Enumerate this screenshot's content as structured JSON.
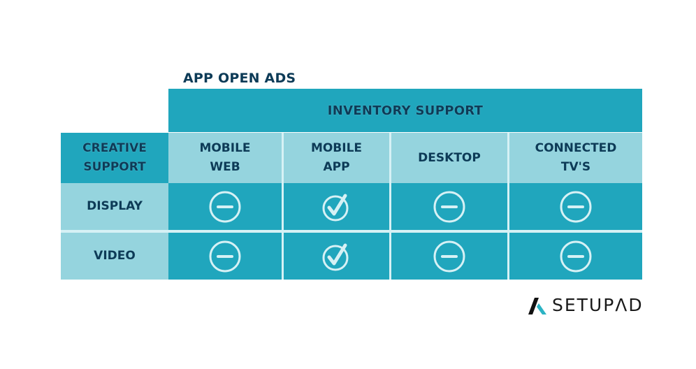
{
  "title": "APP OPEN ADS",
  "table": {
    "group_header": "INVENTORY SUPPORT",
    "corner_label": [
      "CREATIVE",
      "SUPPORT"
    ],
    "columns": [
      {
        "id": "mobile-web",
        "lines": [
          "MOBILE",
          "WEB"
        ]
      },
      {
        "id": "mobile-app",
        "lines": [
          "MOBILE",
          "APP"
        ]
      },
      {
        "id": "desktop",
        "lines": [
          "DESKTOP"
        ]
      },
      {
        "id": "connected-tv",
        "lines": [
          "CONNECTED",
          "TV'S"
        ]
      }
    ],
    "rows": [
      {
        "label": "DISPLAY",
        "cells": [
          "not-supported",
          "supported",
          "not-supported",
          "not-supported"
        ]
      },
      {
        "label": "VIDEO",
        "cells": [
          "not-supported",
          "supported",
          "not-supported",
          "not-supported"
        ]
      }
    ],
    "icon_legend": {
      "supported": "check-circle-icon",
      "not-supported": "minus-circle-icon"
    }
  },
  "logo": {
    "text": "SETUPΛD",
    "mark": "setupad-logo-mark"
  },
  "colors": {
    "dark_teal": "#20a6bd",
    "light_teal": "#95d4de",
    "navy_text": "#0d3b57",
    "icon_stroke": "#d6f1f5",
    "logo_accent": "#2bb3c4"
  }
}
